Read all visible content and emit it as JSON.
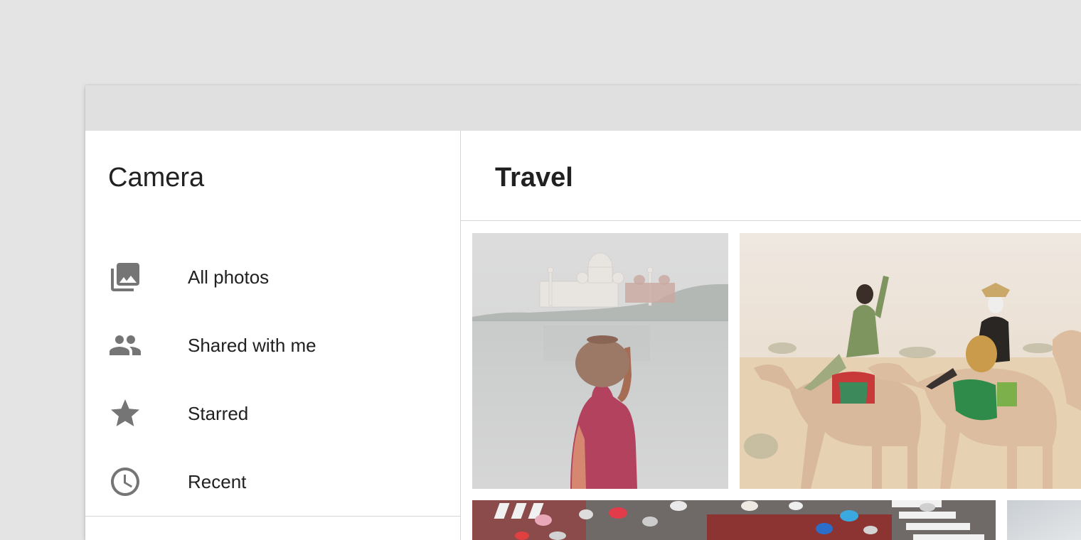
{
  "sidebar": {
    "title": "Camera",
    "items": [
      {
        "label": "All photos",
        "icon": "photo-library-icon"
      },
      {
        "label": "Shared with me",
        "icon": "people-icon"
      },
      {
        "label": "Starred",
        "icon": "star-icon"
      },
      {
        "label": "Recent",
        "icon": "clock-icon"
      }
    ]
  },
  "main": {
    "title": "Travel",
    "photos": [
      {
        "subject": "taj-mahal-river-woman"
      },
      {
        "subject": "camel-riders-desert"
      },
      {
        "subject": "umbrellas-crosswalk"
      },
      {
        "subject": "misty-sky"
      }
    ]
  },
  "colors": {
    "background": "#e4e4e4",
    "titlebar": "#e0e0e0",
    "icon": "#757575",
    "text": "#212121",
    "divider": "#d6d6d6"
  }
}
